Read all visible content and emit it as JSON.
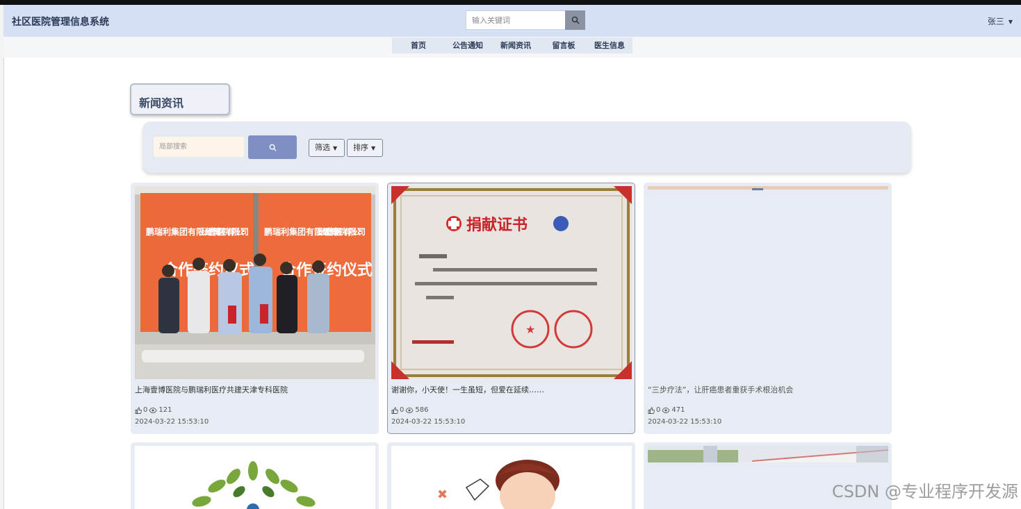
{
  "header": {
    "app_title": "社区医院管理信息系统",
    "search_placeholder": "输入关键词",
    "user_name": "张三"
  },
  "nav": {
    "items": [
      {
        "label": "首页"
      },
      {
        "label": "公告通知"
      },
      {
        "label": "新闻资讯"
      },
      {
        "label": "留言板"
      },
      {
        "label": "医生信息"
      }
    ]
  },
  "section": {
    "title": "新闻资讯"
  },
  "filters": {
    "search_placeholder": "局部搜索",
    "filter_label": "筛选",
    "sort_label": "排序"
  },
  "photo_text": {
    "banner_company_1": "鹏瑞利集团有限公司",
    "banner_company_2": "上海壹博医院有限公司",
    "banner_ceremony": "合作签约仪式",
    "certificate_title": "捐献证书"
  },
  "cards": [
    {
      "title": "上海壹博医院与鹏瑞利医疗共建天津专科医院",
      "likes": "0",
      "views": "121",
      "date": "2024-03-22 15:53:10"
    },
    {
      "title": "谢谢你，小天使！一生虽短，但爱在延续……",
      "likes": "0",
      "views": "586",
      "date": "2024-03-22 15:53:10"
    },
    {
      "title": "“三步疗法”，让肝癌患者重获手术根治机会",
      "likes": "0",
      "views": "471",
      "date": "2024-03-22 15:53:10"
    }
  ],
  "watermark": "CSDN @专业程序开发源",
  "colors": {
    "header_bg": "#d5e0f5",
    "card_bg": "#e6ebf4",
    "search_button": "#7f8fc4"
  }
}
